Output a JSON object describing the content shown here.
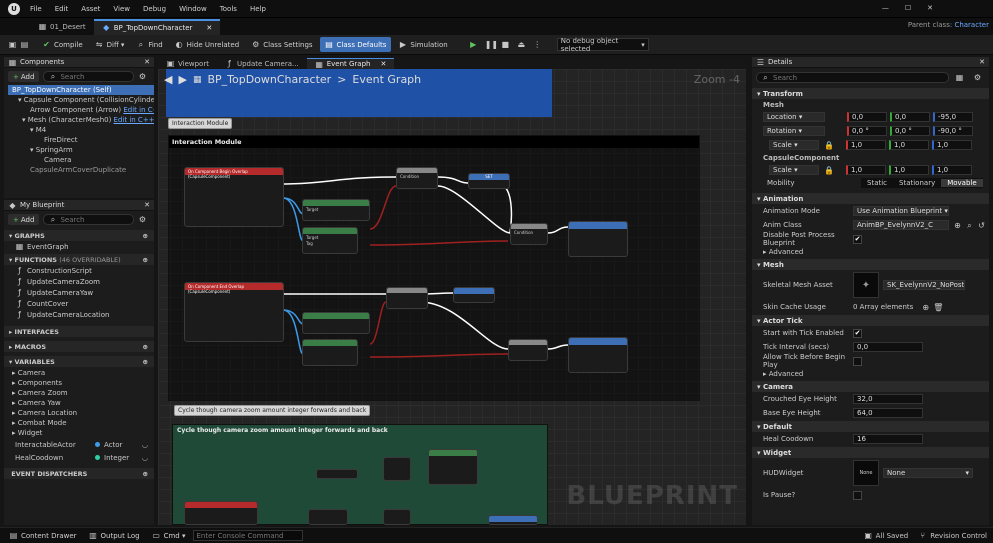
{
  "menu": [
    "File",
    "Edit",
    "Asset",
    "View",
    "Debug",
    "Window",
    "Tools",
    "Help"
  ],
  "parent_class": {
    "label": "Parent class:",
    "value": "Character"
  },
  "tabs": [
    "01_Desert",
    "BP_TopDownCharacter"
  ],
  "toolbar": {
    "compile": "Compile",
    "diff": "Diff",
    "find": "Find",
    "hide_unrelated": "Hide Unrelated",
    "class_settings": "Class Settings",
    "class_defaults": "Class Defaults",
    "simulation": "Simulation",
    "debug_object": "No debug object selected"
  },
  "components": {
    "title": "Components",
    "add": "Add",
    "search_placeholder": "Search",
    "tree": [
      "BP_TopDownCharacter (Self)",
      "Capsule Component (CollisionCylinder)",
      "Arrow Component (Arrow)",
      "Mesh (CharacterMesh0)",
      "M4",
      "FireDirect",
      "SpringArm",
      "Camera",
      "CapsuleArmCoverDuplicate"
    ],
    "edit_in": "Edit in C++"
  },
  "myblueprint": {
    "title": "My Blueprint",
    "add": "Add",
    "search_placeholder": "Search",
    "graphs_label": "GRAPHS",
    "graphs": [
      "EventGraph"
    ],
    "functions_label": "FUNCTIONS",
    "functions_count": "(46 OVERRIDABLE)",
    "functions": [
      "ConstructionScript",
      "UpdateCameraZoom",
      "UpdateCameraYaw",
      "CountCover",
      "UpdateCameraLocation"
    ],
    "interfaces_label": "INTERFACES",
    "macros_label": "MACROS",
    "variables_label": "VARIABLES",
    "var_categories": [
      "Camera",
      "Components",
      "Camera Zoom",
      "Camera Yaw",
      "Camera Location",
      "Combat Mode",
      "Widget"
    ],
    "variables": [
      {
        "name": "InteractableActor",
        "type": "Actor",
        "color": "#3d9be8"
      },
      {
        "name": "HealCoodown",
        "type": "Integer",
        "color": "#2ed1a3"
      }
    ],
    "dispatchers_label": "EVENT DISPATCHERS"
  },
  "graph_tabs": [
    "Viewport",
    "Update Camera...",
    "Event Graph"
  ],
  "graph": {
    "breadcrumb_a": "BP_TopDownCharacter",
    "breadcrumb_sep": ">",
    "breadcrumb_b": "Event Graph",
    "zoom": "Zoom -4",
    "comment1_bubble": "Interaction Module",
    "comment1_title": "Interaction Module",
    "comment2_bubble": "Cycle though camera zoom amount integer forwards and back",
    "comment2_title": "Cycle though camera zoom amount integer forwards and back",
    "watermark": "BLUEPRINT",
    "node_labels": {
      "begin_overlap": "On Component Begin Overlap (CapsuleComponent)",
      "end_overlap": "On Component End Overlap (CapsuleComponent)",
      "branch": "Branch",
      "set": "SET",
      "does_impl": "Does Implement Interface",
      "condition": "Condition",
      "true_l": "True",
      "false_l": "False",
      "target": "Target",
      "return_value": "Return Value",
      "tag": "Tag",
      "cover": "Cover",
      "interactable": "Interactable"
    }
  },
  "details": {
    "title": "Details",
    "search_placeholder": "Search",
    "transform": "Transform",
    "mesh_label": "Mesh",
    "location": {
      "label": "Location",
      "x": "0,0",
      "y": "0,0",
      "z": "-95,0"
    },
    "rotation": {
      "label": "Rotation",
      "x": "0,0 °",
      "y": "0,0 °",
      "z": "-90,0 °"
    },
    "scale": {
      "label": "Scale",
      "x": "1,0",
      "y": "1,0",
      "z": "1,0"
    },
    "capsule_label": "CapsuleComponent",
    "cscale": {
      "label": "Scale",
      "x": "1,0",
      "y": "1,0",
      "z": "1,0"
    },
    "mobility": {
      "label": "Mobility",
      "options": [
        "Static",
        "Stationary",
        "Movable"
      ],
      "selected": "Movable"
    },
    "animation": "Animation",
    "anim_mode": {
      "label": "Animation Mode",
      "value": "Use Animation Blueprint"
    },
    "anim_class": {
      "label": "Anim Class",
      "value": "AnimBP_EvelynnV2_C"
    },
    "disable_pp": {
      "label": "Disable Post Process Blueprint",
      "checked": true
    },
    "advanced": "Advanced",
    "mesh_sec": "Mesh",
    "skel_mesh": {
      "label": "Skeletal Mesh Asset",
      "value": "SK_EvelynnV2_NoPostProcess"
    },
    "skin_cache": {
      "label": "Skin Cache Usage",
      "value": "0 Array elements"
    },
    "actor_tick": "Actor Tick",
    "start_tick": {
      "label": "Start with Tick Enabled",
      "checked": true
    },
    "tick_interval": {
      "label": "Tick Interval (secs)",
      "value": "0,0"
    },
    "allow_tick": {
      "label": "Allow Tick Before Begin Play",
      "checked": false
    },
    "advanced2": "Advanced",
    "camera": "Camera",
    "crouched": {
      "label": "Crouched Eye Height",
      "value": "32,0"
    },
    "base_eye": {
      "label": "Base Eye Height",
      "value": "64,0"
    },
    "default": "Default",
    "heal": {
      "label": "Heal Coodown",
      "value": "16"
    },
    "widget": "Widget",
    "hud": {
      "label": "HUDWidget",
      "thumb": "None",
      "value": "None"
    },
    "is_pause": {
      "label": "Is Pause?"
    }
  },
  "status": {
    "content_drawer": "Content Drawer",
    "output_log": "Output Log",
    "cmd": "Cmd",
    "console_placeholder": "Enter Console Command",
    "all_saved": "All Saved",
    "revision": "Revision Control"
  }
}
